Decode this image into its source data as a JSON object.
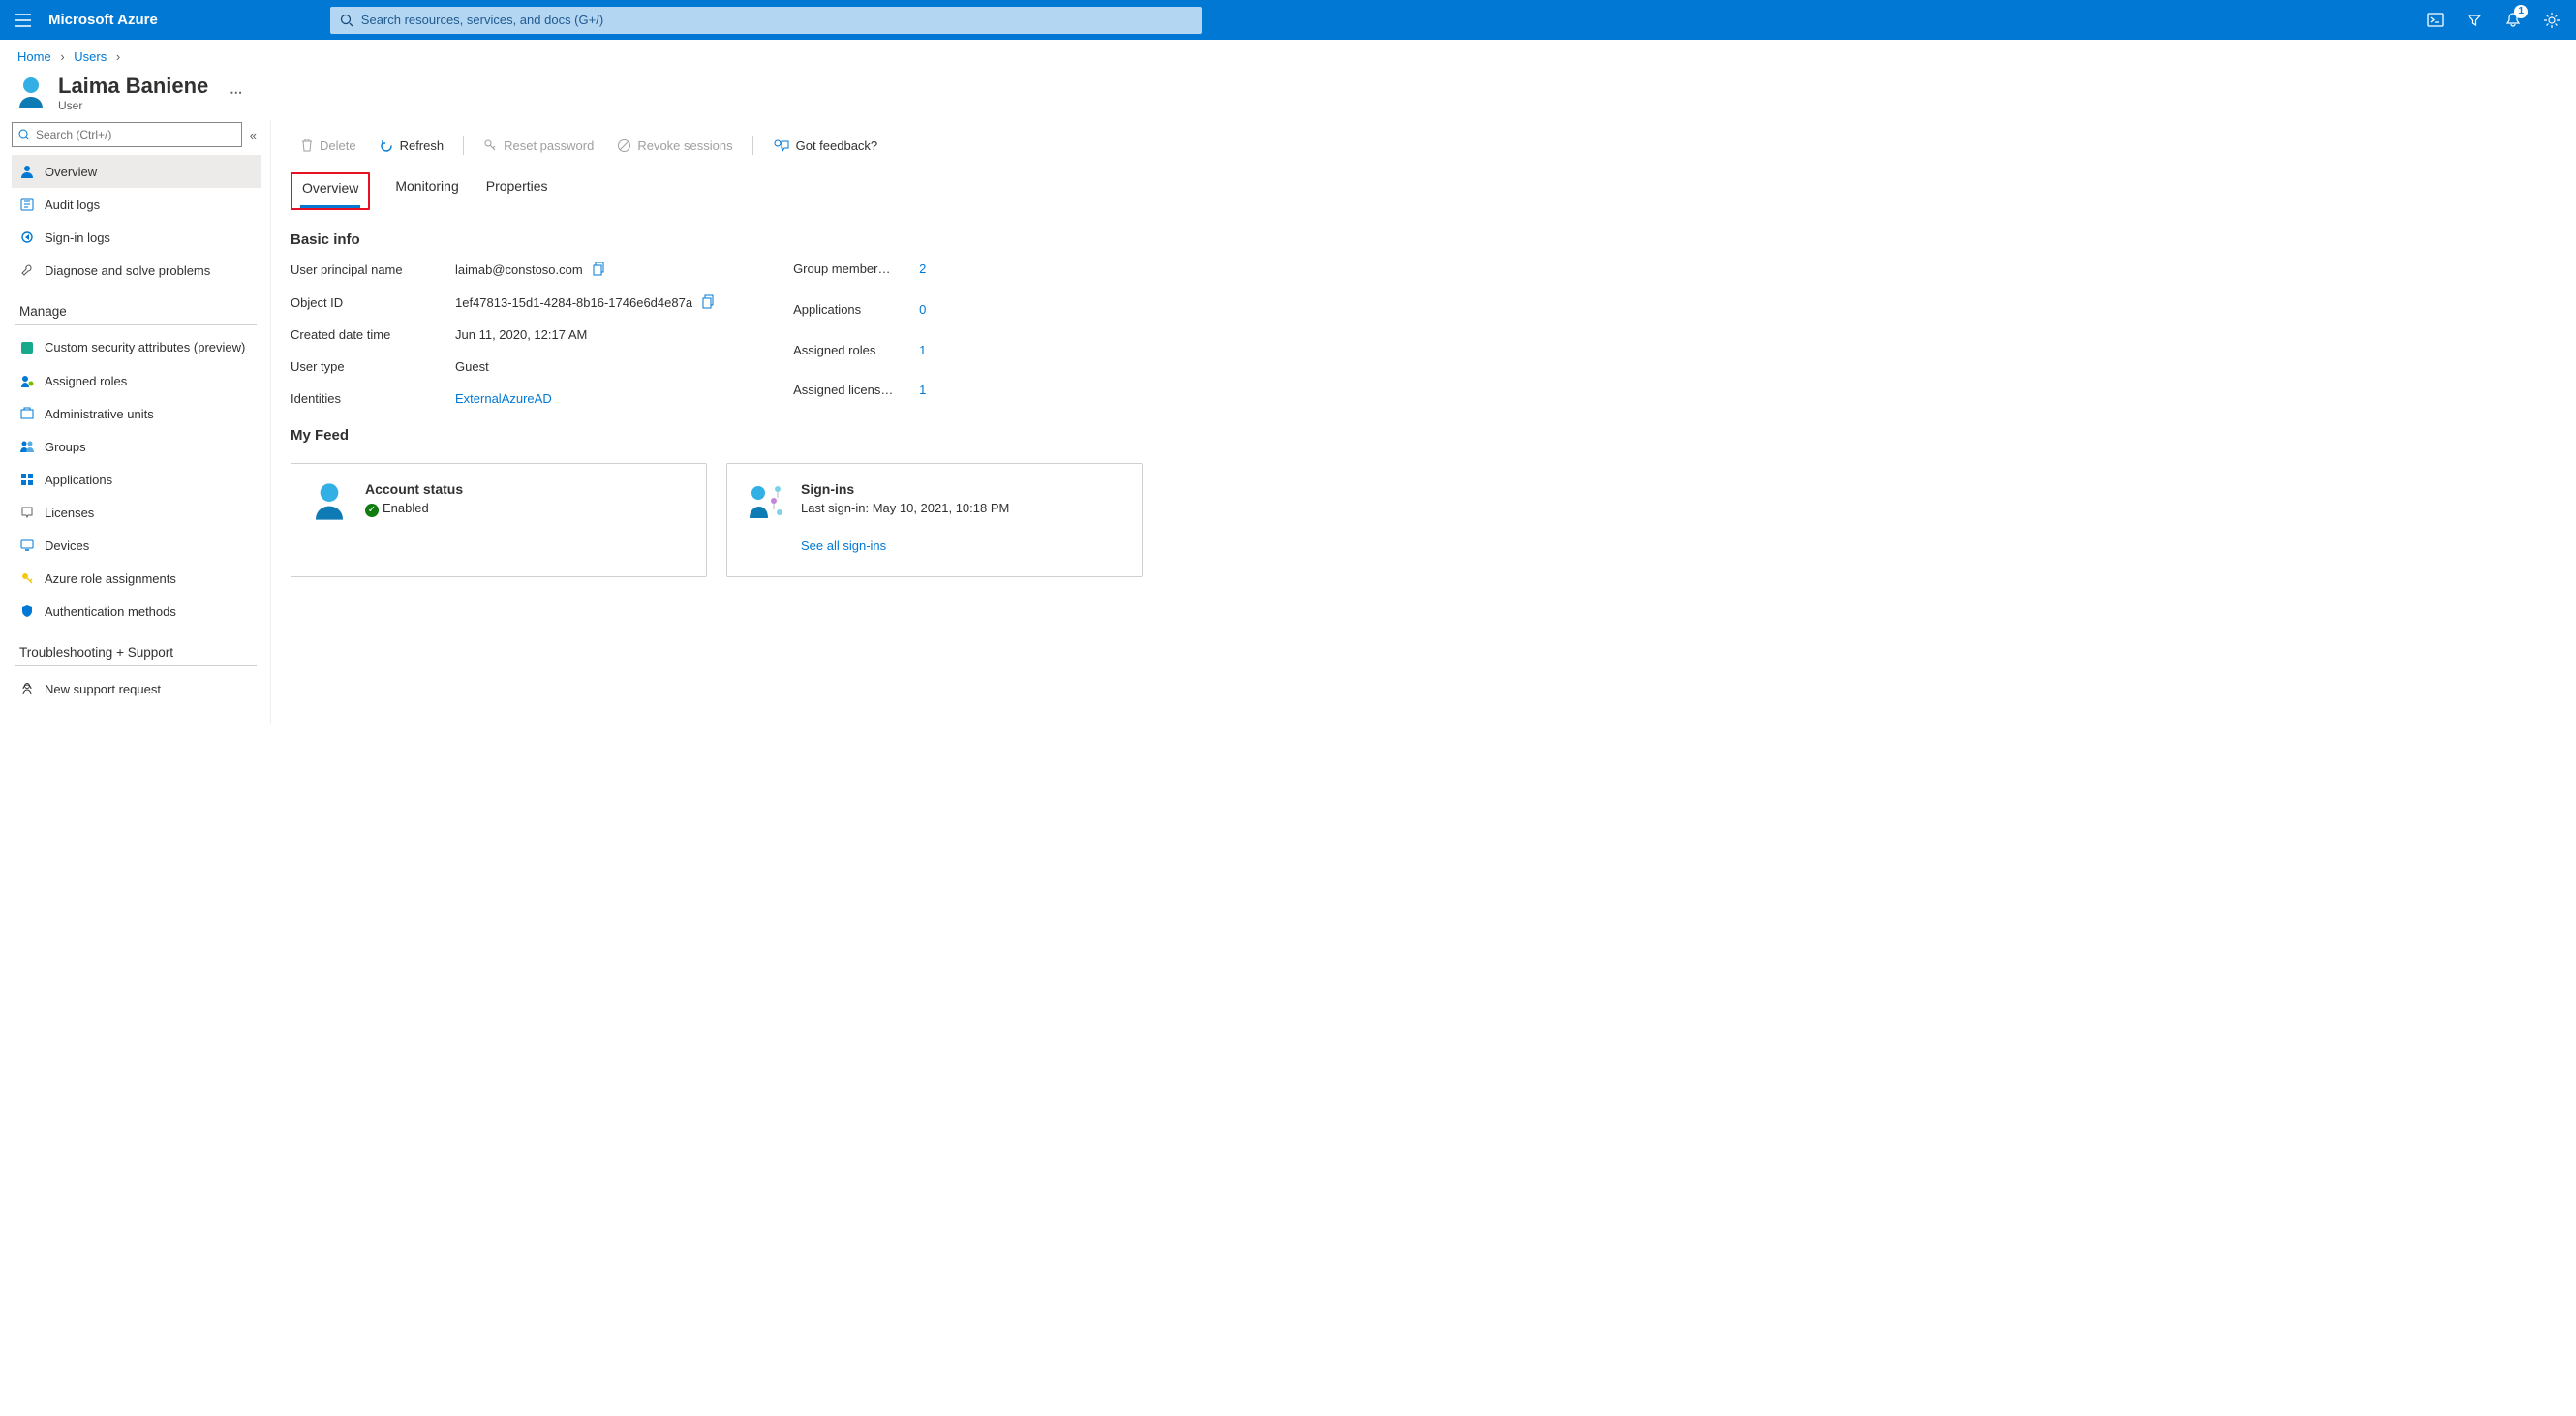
{
  "header": {
    "brand": "Microsoft Azure",
    "search_placeholder": "Search resources, services, and docs (G+/)",
    "notification_count": "1"
  },
  "breadcrumb": {
    "home": "Home",
    "users": "Users"
  },
  "page": {
    "title": "Laima Baniene",
    "subtitle": "User"
  },
  "sidebar": {
    "search_placeholder": "Search (Ctrl+/)",
    "items": [
      {
        "label": "Overview"
      },
      {
        "label": "Audit logs"
      },
      {
        "label": "Sign-in logs"
      },
      {
        "label": "Diagnose and solve problems"
      }
    ],
    "manage_header": "Manage",
    "manage": [
      {
        "label": "Custom security attributes (preview)"
      },
      {
        "label": "Assigned roles"
      },
      {
        "label": "Administrative units"
      },
      {
        "label": "Groups"
      },
      {
        "label": "Applications"
      },
      {
        "label": "Licenses"
      },
      {
        "label": "Devices"
      },
      {
        "label": "Azure role assignments"
      },
      {
        "label": "Authentication methods"
      }
    ],
    "troubleshoot_header": "Troubleshooting + Support",
    "troubleshoot": [
      {
        "label": "New support request"
      }
    ]
  },
  "toolbar": {
    "delete": "Delete",
    "refresh": "Refresh",
    "reset_password": "Reset password",
    "revoke_sessions": "Revoke sessions",
    "feedback": "Got feedback?"
  },
  "tabs": {
    "overview": "Overview",
    "monitoring": "Monitoring",
    "properties": "Properties"
  },
  "sections": {
    "basic_info": "Basic info",
    "my_feed": "My Feed"
  },
  "info": {
    "upn_label": "User principal name",
    "upn_value": "laimab@constoso.com",
    "object_id_label": "Object ID",
    "object_id_value": "1ef47813-15d1-4284-8b16-1746e6d4e87a",
    "created_label": "Created date time",
    "created_value": "Jun 11, 2020, 12:17 AM",
    "user_type_label": "User type",
    "user_type_value": "Guest",
    "identities_label": "Identities",
    "identities_value": "ExternalAzureAD"
  },
  "counts": {
    "group_label": "Group member…",
    "group_value": "2",
    "apps_label": "Applications",
    "apps_value": "0",
    "roles_label": "Assigned roles",
    "roles_value": "1",
    "licenses_label": "Assigned licens…",
    "licenses_value": "1"
  },
  "feed": {
    "account_status_title": "Account status",
    "account_status_value": "Enabled",
    "signins_title": "Sign-ins",
    "signins_text": "Last sign-in: May 10, 2021, 10:18 PM",
    "signins_link": "See all sign-ins"
  }
}
